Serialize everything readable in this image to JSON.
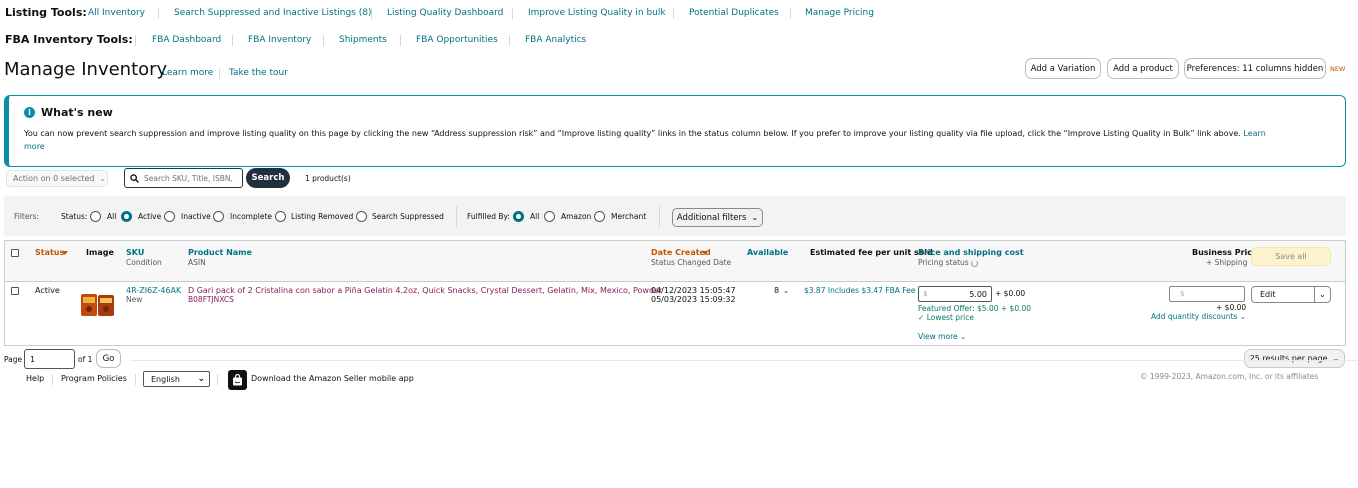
{
  "listing_tools": {
    "label": "Listing Tools:",
    "links": [
      "All Inventory",
      "Search Suppressed and Inactive Listings (8)",
      "Listing Quality Dashboard",
      "Improve Listing Quality in bulk",
      "Potential Duplicates",
      "Manage Pricing"
    ]
  },
  "fba_tools": {
    "label": "FBA Inventory Tools:",
    "links": [
      "FBA Dashboard",
      "FBA Inventory",
      "Shipments",
      "FBA Opportunities",
      "FBA Analytics"
    ]
  },
  "header": {
    "title": "Manage Inventory",
    "learn_more": "Learn more",
    "take_tour": "Take the tour",
    "add_variation": "Add a Variation",
    "add_product": "Add a product",
    "preferences": "Preferences: 11 columns hidden",
    "new_badge": "NEW"
  },
  "whats_new": {
    "title": "What's new",
    "body": "You can now prevent search suppression and improve listing quality on this page by clicking the new “Address suppression risk” and “Improve listing quality” links in the status column below. If you prefer to improve your listing quality via file upload, click the “Improve Listing Quality in Bulk” link above.",
    "link_learn": "Learn",
    "link_more": "more"
  },
  "toolbar": {
    "action_label": "Action on 0 selected",
    "search_placeholder": "Search SKU, Title, ISBN,",
    "search_button": "Search",
    "product_count": "1 product(s)"
  },
  "filters": {
    "label": "Filters:",
    "status_label": "Status:",
    "status_options": [
      "All",
      "Active",
      "Inactive",
      "Incomplete",
      "Listing Removed",
      "Search Suppressed"
    ],
    "status_selected": "Active",
    "fulfilled_label": "Fulfilled By:",
    "fulfilled_options": [
      "All",
      "Amazon",
      "Merchant"
    ],
    "fulfilled_selected": "All",
    "additional": "Additional filters"
  },
  "table": {
    "headers": {
      "status": "Status",
      "image": "Image",
      "sku": "SKU",
      "sku_sub": "Condition",
      "product_name": "Product Name",
      "product_sub": "ASIN",
      "date_created": "Date Created",
      "date_sub": "Status Changed Date",
      "available": "Available",
      "fee": "Estimated fee per unit sold",
      "price": "Price and shipping cost",
      "price_sub": "Pricing status",
      "business": "Business Price",
      "business_sub": "+ Shipping",
      "save_all": "Save all"
    },
    "row": {
      "status": "Active",
      "sku": "4R-ZI6Z-46AK",
      "condition": "New",
      "product_name": "D Gari pack of 2 Cristalina con sabor a Piña Gelatin 4.2oz, Quick Snacks, Crystal Dessert, Gelatin, Mix, Mexico, Powder",
      "asin": "B08FTJNXCS",
      "date_created": "04/12/2023 15:05:47",
      "status_changed": "05/03/2023 15:09:32",
      "available": "8",
      "fee": "$3.87 Includes $3.47 FBA Fee",
      "currency_symbol": "$",
      "price_value": "5.00",
      "shipping": "+ $0.00",
      "featured_offer": "Featured Offer: $5.00 + $0.00",
      "lowest_price": "Lowest price",
      "view_more": "View more",
      "business_placeholder": "$",
      "business_shipping": "+ $0.00",
      "add_quantity": "Add quantity discounts",
      "edit": "Edit"
    }
  },
  "pagination": {
    "page_label": "Page",
    "page_value": "1",
    "of_label": "of 1",
    "go": "Go",
    "results_per_page": "25 results per page"
  },
  "footer": {
    "help": "Help",
    "program_policies": "Program Policies",
    "language": "English",
    "app_text": "Download the Amazon Seller mobile app",
    "copyright": "© 1999-2023, Amazon.com, Inc. or its affiliates"
  }
}
